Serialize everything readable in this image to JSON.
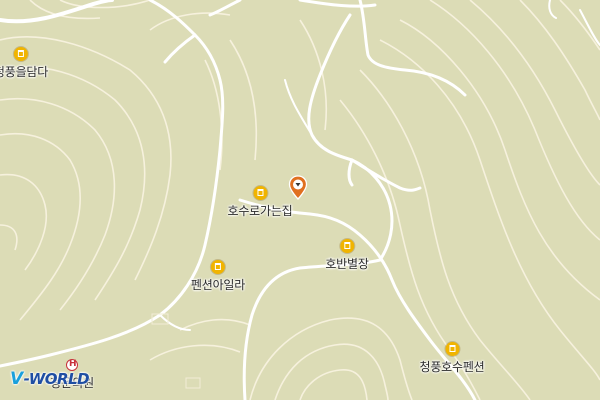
{
  "map": {
    "background": "#dcdcb6",
    "contour_color": "#fbf7ea",
    "road_color": "#ffffff",
    "poi_color": "#f0b400",
    "marker_color": "#e07020"
  },
  "pois": [
    {
      "id": "poi-cheongpung-eulamda",
      "label": "청풍을담다",
      "icon": "building-icon"
    },
    {
      "id": "poi-hosuro-ganeunjip",
      "label": "호수로가는집",
      "icon": "building-icon"
    },
    {
      "id": "poi-hoban-byeoljang",
      "label": "호반별장",
      "icon": "building-icon"
    },
    {
      "id": "poi-pension-aila",
      "label": "펜션아일라",
      "icon": "building-icon"
    },
    {
      "id": "poi-cheongpung-hosu-pension",
      "label": "청풍호수펜션",
      "icon": "building-icon"
    }
  ],
  "hospital": {
    "label": "청운의원",
    "icon": "hospital-icon"
  },
  "logo": {
    "prefix": "V",
    "text": "-WORLD"
  }
}
